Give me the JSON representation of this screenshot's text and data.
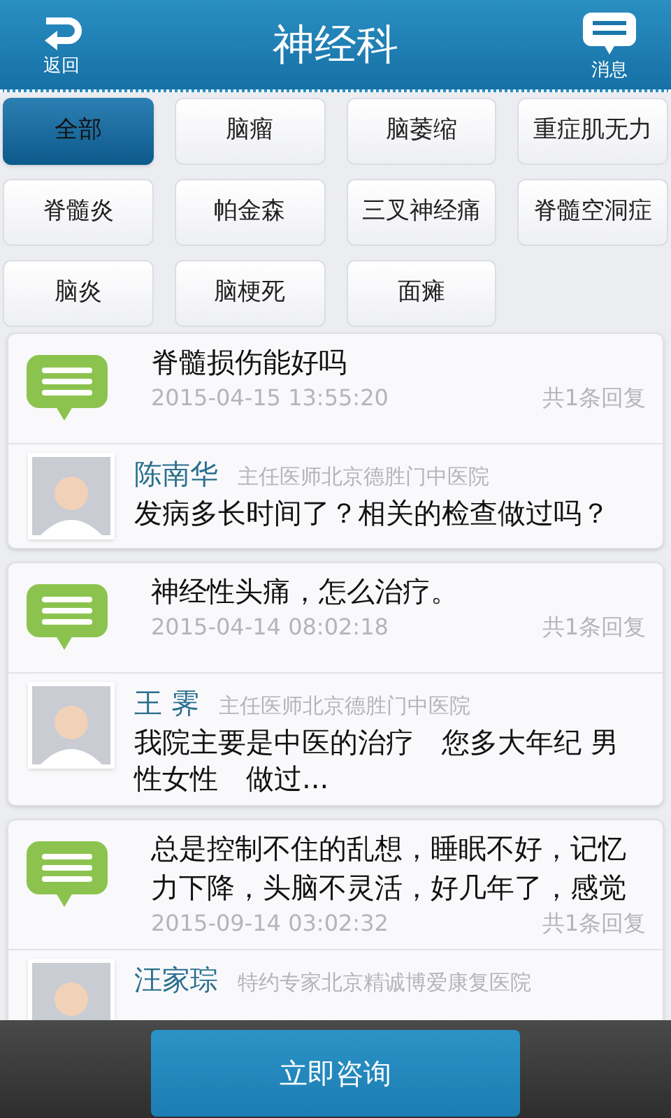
{
  "header": {
    "title": "神经科",
    "back_label": "返回",
    "messages_label": "消息"
  },
  "categories": [
    {
      "label": "全部",
      "selected": true
    },
    {
      "label": "脑瘤",
      "selected": false
    },
    {
      "label": "脑萎缩",
      "selected": false
    },
    {
      "label": "重症肌无力",
      "selected": false
    },
    {
      "label": "脊髓炎",
      "selected": false
    },
    {
      "label": "帕金森",
      "selected": false
    },
    {
      "label": "三叉神经痛",
      "selected": false
    },
    {
      "label": "脊髓空洞症",
      "selected": false
    },
    {
      "label": "脑炎",
      "selected": false
    },
    {
      "label": "脑梗死",
      "selected": false
    },
    {
      "label": "面瘫",
      "selected": false
    }
  ],
  "questions": [
    {
      "text": "脊髓损伤能好吗",
      "date": "2015-04-15 13:55:20",
      "reply_count": "共1条回复",
      "doctor": {
        "name": "陈南华",
        "title": "主任医师北京德胜门中医院",
        "reply": "发病多长时间了？相关的检查做过吗？"
      }
    },
    {
      "text": "神经性头痛，怎么治疗。",
      "date": "2015-04-14 08:02:18",
      "reply_count": "共1条回复",
      "doctor": {
        "name": "王 霁",
        "title": "主任医师北京德胜门中医院",
        "reply": "我院主要是中医的治疗　您多大年纪 男性女性　做过..."
      }
    },
    {
      "text": "总是控制不住的乱想，睡眠不好，记忆力下降，头脑不灵活，好几年了，感觉",
      "date": "2015-09-14 03:02:32",
      "reply_count": "共1条回复",
      "doctor": {
        "name": "汪家琮",
        "title": "特约专家北京精诚博爱康复医院"
      }
    }
  ],
  "consult_button": "立即咨询"
}
